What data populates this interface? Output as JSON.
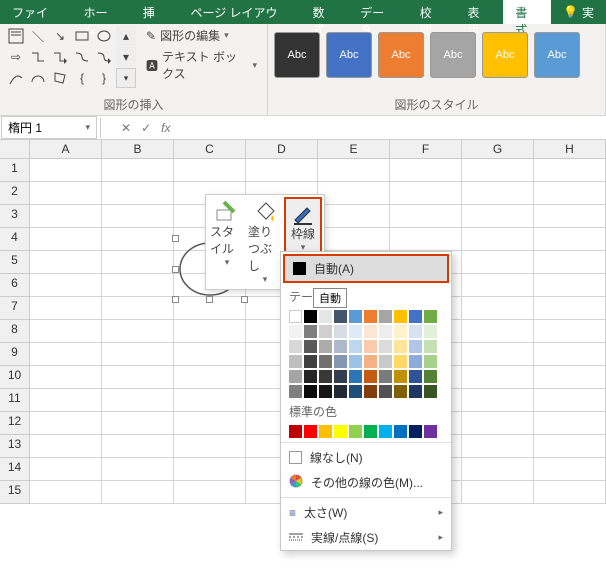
{
  "tabs": {
    "file": "ファイル",
    "home": "ホーム",
    "insert": "挿入",
    "pagelayout": "ページ レイアウト",
    "formulas": "数式",
    "data": "データ",
    "review": "校閲",
    "view": "表示",
    "format": "書式",
    "tell": "実"
  },
  "ribbon": {
    "group1_label": "図形の挿入",
    "edit_shape": "図形の編集",
    "text_box": "テキスト ボックス",
    "group2_label": "図形のスタイル",
    "swatch": "Abc"
  },
  "namebox": "楕円 1",
  "fx": "fx",
  "cols": [
    "A",
    "B",
    "C",
    "D",
    "E",
    "F",
    "G",
    "H"
  ],
  "rows": [
    "1",
    "2",
    "3",
    "4",
    "5",
    "6",
    "7",
    "8",
    "9",
    "10",
    "11",
    "12",
    "13",
    "14",
    "15"
  ],
  "mini": {
    "style": "スタイル",
    "fill": "塗りつぶし",
    "outline": "枠線"
  },
  "dd": {
    "auto": "自動(A)",
    "theme": "テーマ",
    "tooltip": "自動",
    "standard": "標準の色",
    "noline": "線なし(N)",
    "more": "その他の線の色(M)...",
    "weight": "太さ(W)",
    "dashes": "実線/点線(S)"
  },
  "theme_row1": [
    "#ffffff",
    "#000000",
    "#e7e6e6",
    "#44546a",
    "#5b9bd5",
    "#ed7d31",
    "#a5a5a5",
    "#ffc000",
    "#4472c4",
    "#70ad47"
  ],
  "theme_shades": [
    [
      "#f2f2f2",
      "#7f7f7f",
      "#d0cece",
      "#d6dce4",
      "#deebf6",
      "#fbe5d5",
      "#ededed",
      "#fff2cc",
      "#d9e2f3",
      "#e2efd9"
    ],
    [
      "#d8d8d8",
      "#595959",
      "#aeabab",
      "#adb9ca",
      "#bdd7ee",
      "#f7cbac",
      "#dbdbdb",
      "#fee599",
      "#b4c6e7",
      "#c5e0b3"
    ],
    [
      "#bfbfbf",
      "#3f3f3f",
      "#757070",
      "#8496b0",
      "#9cc3e5",
      "#f4b183",
      "#c9c9c9",
      "#ffd965",
      "#8eaadb",
      "#a8d08d"
    ],
    [
      "#a5a5a5",
      "#262626",
      "#3a3838",
      "#323f4f",
      "#2e75b5",
      "#c55a11",
      "#7b7b7b",
      "#bf9000",
      "#2f5496",
      "#538135"
    ],
    [
      "#7f7f7f",
      "#0c0c0c",
      "#171616",
      "#222a35",
      "#1e4e79",
      "#833c0b",
      "#525252",
      "#7f6000",
      "#1f3864",
      "#375623"
    ]
  ],
  "standard_colors": [
    "#c00000",
    "#ff0000",
    "#ffc000",
    "#ffff00",
    "#92d050",
    "#00b050",
    "#00b0f0",
    "#0070c0",
    "#002060",
    "#7030a0"
  ],
  "style_colors": [
    "#333333",
    "#4472c4",
    "#ed7d31",
    "#a5a5a5",
    "#ffc000",
    "#5b9bd5"
  ]
}
